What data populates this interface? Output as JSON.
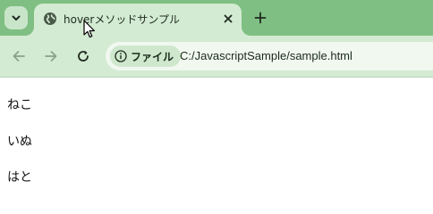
{
  "browser": {
    "tab": {
      "title": "hoverメソッドサンプル"
    },
    "toolbar": {
      "site_chip_label": "ファイル",
      "url": "C:/JavascriptSample/sample.html"
    },
    "icons": {
      "tab_search": "chevron-down-icon",
      "favicon": "globe-icon",
      "close": "close-icon",
      "new_tab": "plus-icon",
      "back": "back-arrow-icon",
      "forward": "forward-arrow-icon",
      "reload": "reload-icon",
      "info": "info-icon",
      "cursor": "mouse-pointer-icon"
    },
    "colors": {
      "tabstrip": "#7fbf83",
      "active_tab": "#d3ebd2",
      "toolbar": "#d3ebd2",
      "omnibox": "#f1f8f0"
    }
  },
  "page": {
    "items": [
      "ねこ",
      "いぬ",
      "はと"
    ]
  }
}
